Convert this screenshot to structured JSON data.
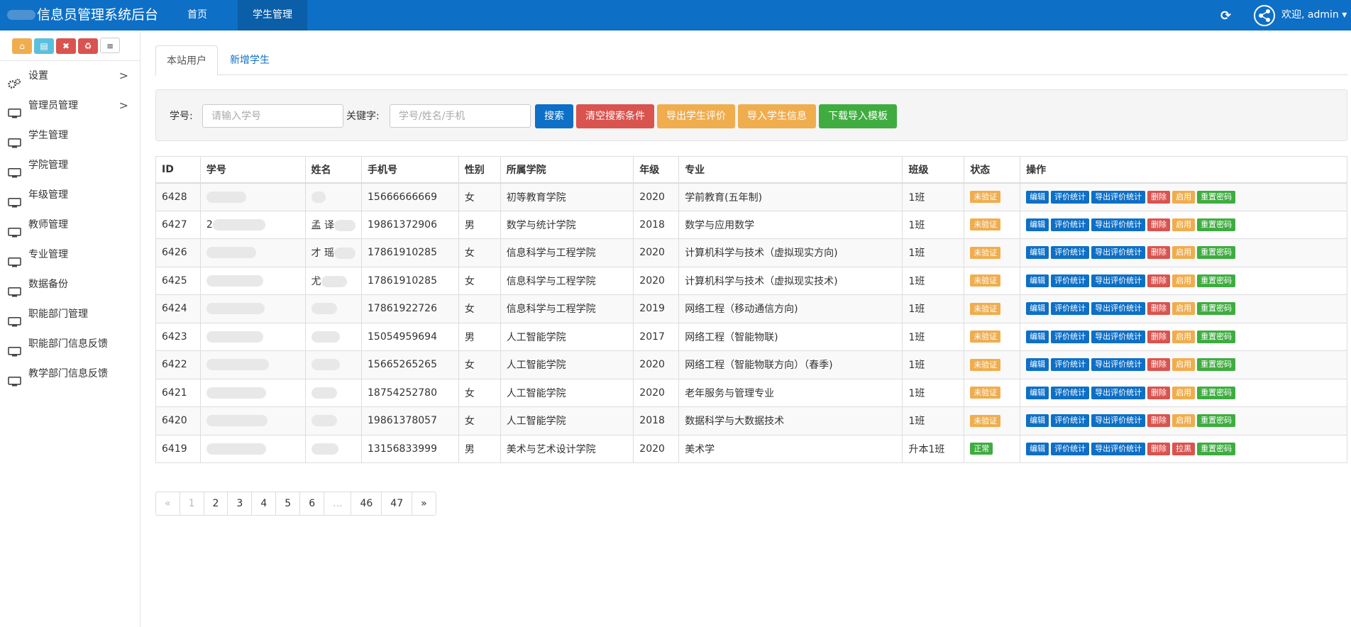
{
  "header": {
    "brand_text": "信息员管理系统后台",
    "nav": [
      {
        "label": "首页"
      },
      {
        "label": "学生管理",
        "active": true
      }
    ],
    "welcome": "欢迎, admin ▾",
    "refresh_icon": "refresh-icon",
    "colors": {
      "primary": "#0e6fc6",
      "active_nav": "#0b5ea8"
    }
  },
  "sidebar": {
    "shortcuts": [
      {
        "name": "home-icon",
        "glyph": "⌂"
      },
      {
        "name": "file-icon",
        "glyph": "▤"
      },
      {
        "name": "trash-icon",
        "glyph": "🗑"
      },
      {
        "name": "recycle-icon",
        "glyph": "♻"
      },
      {
        "name": "list-icon",
        "glyph": "≡"
      }
    ],
    "items": [
      {
        "label": "设置",
        "icon": "gears-icon",
        "chevron": ">"
      },
      {
        "label": "管理员管理",
        "icon": "monitor-icon",
        "chevron": ">"
      },
      {
        "label": "学生管理",
        "icon": "monitor-icon"
      },
      {
        "label": "学院管理",
        "icon": "monitor-icon"
      },
      {
        "label": "年级管理",
        "icon": "monitor-icon"
      },
      {
        "label": "教师管理",
        "icon": "monitor-icon"
      },
      {
        "label": "专业管理",
        "icon": "monitor-icon"
      },
      {
        "label": "数据备份",
        "icon": "monitor-icon"
      },
      {
        "label": "职能部门管理",
        "icon": "monitor-icon"
      },
      {
        "label": "职能部门信息反馈",
        "icon": "monitor-icon"
      },
      {
        "label": "教学部门信息反馈",
        "icon": "monitor-icon"
      }
    ]
  },
  "tabs": [
    {
      "label": "本站用户",
      "active": true
    },
    {
      "label": "新增学生"
    }
  ],
  "search": {
    "student_no_label": "学号:",
    "student_no_placeholder": "请输入学号",
    "keyword_label": "关键字:",
    "keyword_placeholder": "学号/姓名/手机",
    "buttons": [
      {
        "label": "搜索",
        "color": "#0e6fc6"
      },
      {
        "label": "清空搜索条件",
        "color": "#d9534f"
      },
      {
        "label": "导出学生评价",
        "color": "#f0ad4e"
      },
      {
        "label": "导入学生信息",
        "color": "#f0ad4e"
      },
      {
        "label": "下载导入模板",
        "color": "#3fac40"
      }
    ]
  },
  "table": {
    "columns": [
      "ID",
      "学号",
      "姓名",
      "手机号",
      "性别",
      "所属学院",
      "年级",
      "专业",
      "班级",
      "状态",
      "操作"
    ],
    "rows": [
      {
        "id": "6428",
        "student_no": "",
        "name": "",
        "phone": "15666666669",
        "gender": "女",
        "college": "初等教育学院",
        "grade": "2020",
        "major": "学前教育(五年制)",
        "class": "1班",
        "status": "未验证",
        "toggle": "启用"
      },
      {
        "id": "6427",
        "student_no": "2",
        "name": "孟 译",
        "phone": "19861372906",
        "gender": "男",
        "college": "数学与统计学院",
        "grade": "2018",
        "major": "数学与应用数学",
        "class": "1班",
        "status": "未验证",
        "toggle": "启用"
      },
      {
        "id": "6426",
        "student_no": "",
        "name": "才 瑶",
        "phone": "17861910285",
        "gender": "女",
        "college": "信息科学与工程学院",
        "grade": "2020",
        "major": "计算机科学与技术（虚拟现实方向)",
        "class": "1班",
        "status": "未验证",
        "toggle": "启用"
      },
      {
        "id": "6425",
        "student_no": "",
        "name": "尤",
        "phone": "17861910285",
        "gender": "女",
        "college": "信息科学与工程学院",
        "grade": "2020",
        "major": "计算机科学与技术（虚拟现实技术)",
        "class": "1班",
        "status": "未验证",
        "toggle": "启用"
      },
      {
        "id": "6424",
        "student_no": "",
        "name": "",
        "phone": "17861922726",
        "gender": "女",
        "college": "信息科学与工程学院",
        "grade": "2019",
        "major": "网络工程（移动通信方向)",
        "class": "1班",
        "status": "未验证",
        "toggle": "启用"
      },
      {
        "id": "6423",
        "student_no": "",
        "name": "",
        "phone": "15054959694",
        "gender": "男",
        "college": "人工智能学院",
        "grade": "2017",
        "major": "网络工程（智能物联)",
        "class": "1班",
        "status": "未验证",
        "toggle": "启用"
      },
      {
        "id": "6422",
        "student_no": "",
        "name": "",
        "phone": "15665265265",
        "gender": "女",
        "college": "人工智能学院",
        "grade": "2020",
        "major": "网络工程（智能物联方向）（春季)",
        "class": "1班",
        "status": "未验证",
        "toggle": "启用"
      },
      {
        "id": "6421",
        "student_no": "",
        "name": "",
        "phone": "18754252780",
        "gender": "女",
        "college": "人工智能学院",
        "grade": "2020",
        "major": "老年服务与管理专业",
        "class": "1班",
        "status": "未验证",
        "toggle": "启用"
      },
      {
        "id": "6420",
        "student_no": "",
        "name": "",
        "phone": "19861378057",
        "gender": "女",
        "college": "人工智能学院",
        "grade": "2018",
        "major": "数据科学与大数据技术",
        "class": "1班",
        "status": "未验证",
        "toggle": "启用"
      },
      {
        "id": "6419",
        "student_no": "",
        "name": "",
        "phone": "13156833999",
        "gender": "男",
        "college": "美术与艺术设计学院",
        "grade": "2020",
        "major": "美术学",
        "class": "升本1班",
        "status": "正常",
        "toggle": "拉黑"
      }
    ],
    "actions": {
      "edit": "编辑",
      "stats": "评价统计",
      "export": "导出评价统计",
      "delete": "删除",
      "reset": "重置密码"
    }
  },
  "pagination": {
    "pages": [
      "«",
      "1",
      "2",
      "3",
      "4",
      "5",
      "6",
      "...",
      "46",
      "47",
      "»"
    ],
    "current": "1"
  }
}
